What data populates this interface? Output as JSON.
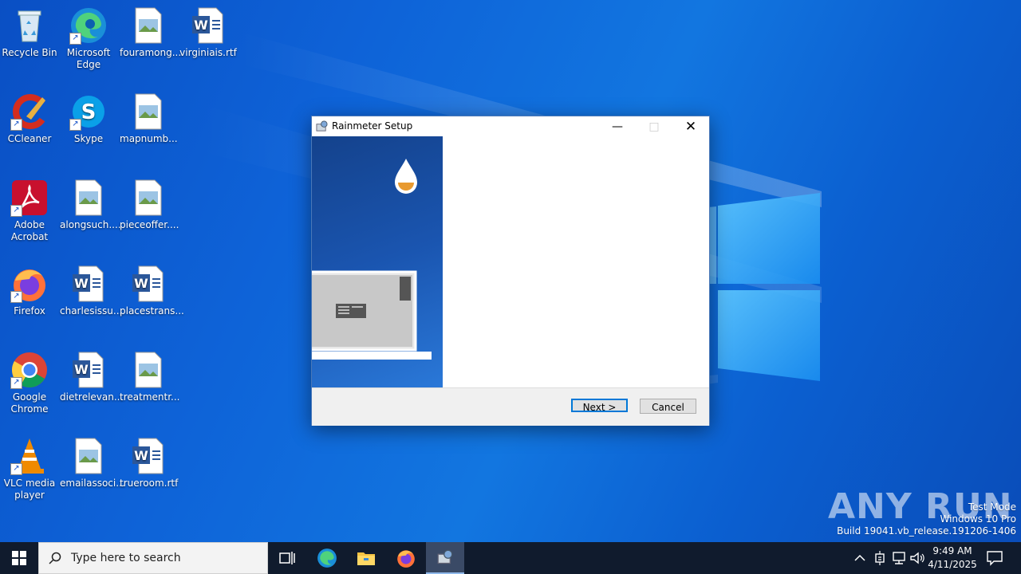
{
  "desktop": {
    "icons": [
      {
        "label": "Recycle Bin",
        "icon": "recycle-bin-icon"
      },
      {
        "label": "Microsoft Edge",
        "icon": "edge-icon"
      },
      {
        "label": "fouramong...",
        "icon": "image-file-icon"
      },
      {
        "label": "virginiais.rtf",
        "icon": "word-doc-icon"
      },
      {
        "label": "CCleaner",
        "icon": "ccleaner-icon"
      },
      {
        "label": "Skype",
        "icon": "skype-icon"
      },
      {
        "label": "mapnumb...",
        "icon": "image-file-icon"
      },
      {
        "label": "Adobe Acrobat",
        "icon": "acrobat-icon"
      },
      {
        "label": "alongsuch....",
        "icon": "image-file-icon"
      },
      {
        "label": "pieceoffer....",
        "icon": "image-file-icon"
      },
      {
        "label": "Firefox",
        "icon": "firefox-icon"
      },
      {
        "label": "charlesissu...",
        "icon": "word-doc-icon"
      },
      {
        "label": "placestrans...",
        "icon": "word-doc-icon"
      },
      {
        "label": "Google Chrome",
        "icon": "chrome-icon"
      },
      {
        "label": "dietrelevan...",
        "icon": "word-doc-icon"
      },
      {
        "label": "treatmentr...",
        "icon": "image-file-icon"
      },
      {
        "label": "VLC media player",
        "icon": "vlc-icon"
      },
      {
        "label": "emailassoci...",
        "icon": "image-file-icon"
      },
      {
        "label": "trueroom.rtf",
        "icon": "word-doc-icon"
      }
    ]
  },
  "dialog": {
    "title": "Rainmeter Setup",
    "next_label": "Next >",
    "cancel_label": "Cancel"
  },
  "taskbar": {
    "search_placeholder": "Type here to search",
    "time": "9:49 AM",
    "date": "4/11/2025"
  },
  "watermark": {
    "line1": "Test Mode",
    "line2": "Windows 10 Pro",
    "line3": "Build 19041.vb_release.191206-1406",
    "brand": "ANY RUN"
  }
}
